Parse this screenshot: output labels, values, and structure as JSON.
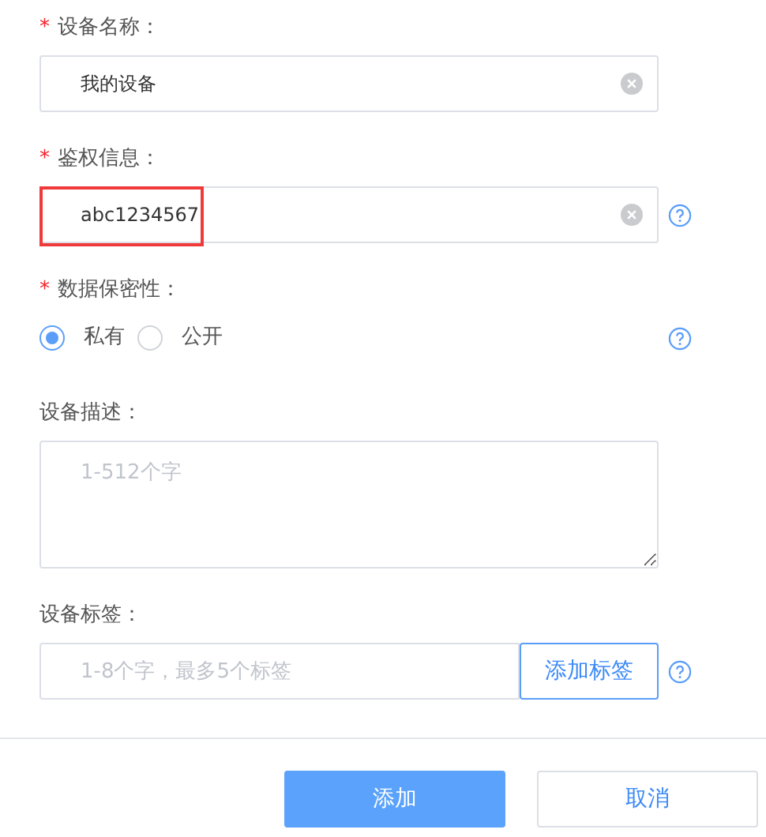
{
  "form": {
    "fields": [
      {
        "kind": "text",
        "required_mark": "*",
        "label": "设备名称：",
        "value": "我的设备",
        "clearable": true
      },
      {
        "kind": "text",
        "required_mark": "*",
        "label": "鉴权信息：",
        "value": "abc1234567",
        "clearable": true,
        "highlighted": true,
        "help": true
      },
      {
        "kind": "radio",
        "required_mark": "*",
        "label": "数据保密性：",
        "options": [
          {
            "label": "私有",
            "selected": true
          },
          {
            "label": "公开",
            "selected": false
          }
        ],
        "help": true
      },
      {
        "kind": "textarea",
        "label": "设备描述：",
        "placeholder": "1-512个字"
      },
      {
        "kind": "tags",
        "label": "设备标签：",
        "placeholder": "1-8个字，最多5个标签",
        "button": "添加标签",
        "help": true
      }
    ]
  },
  "footer": {
    "buttons": [
      {
        "label": "添加",
        "kind": "primary"
      },
      {
        "label": "取消",
        "kind": "secondary"
      }
    ]
  }
}
